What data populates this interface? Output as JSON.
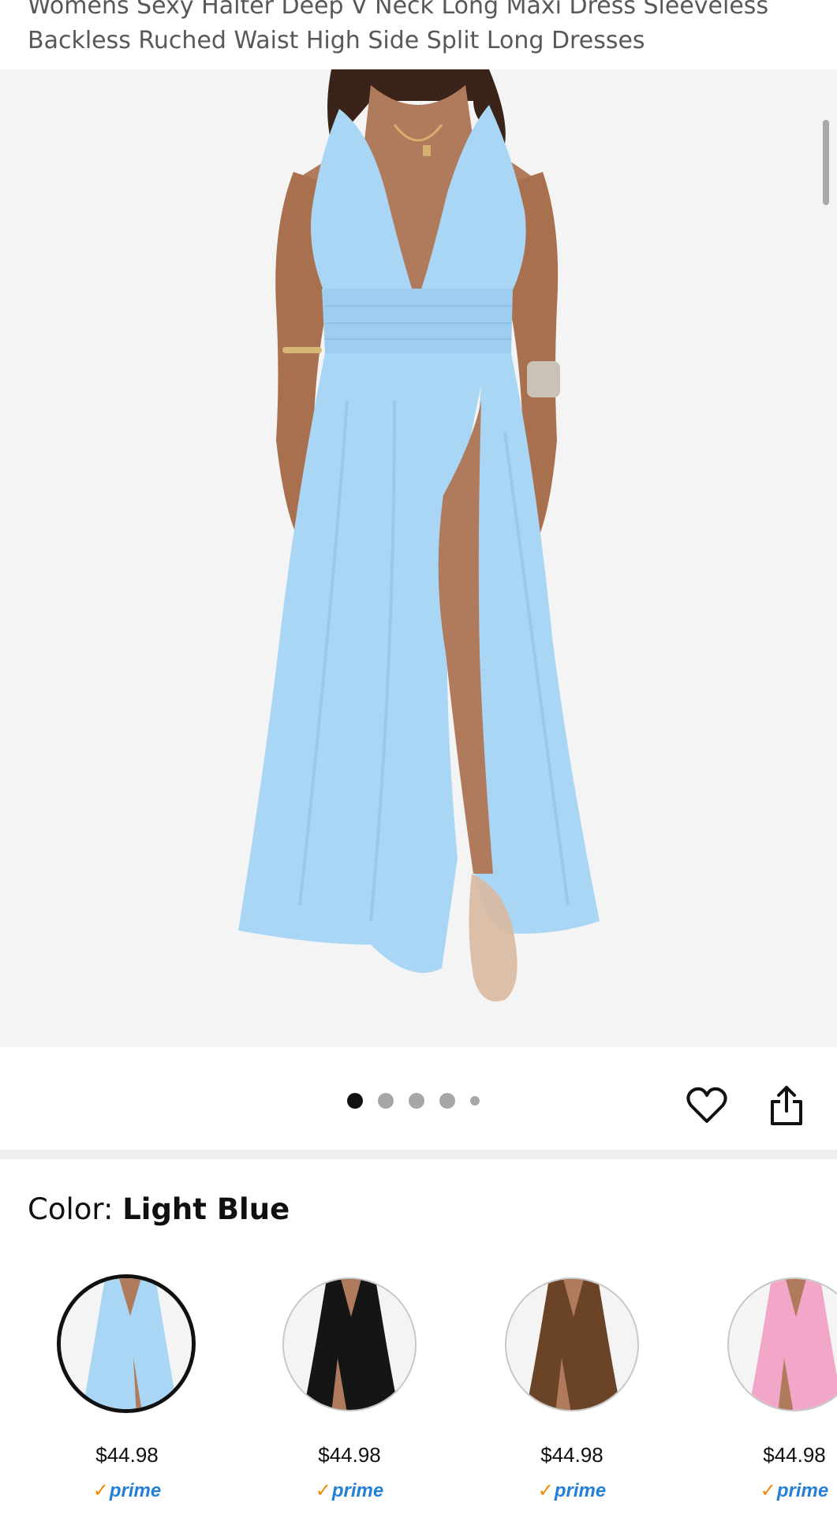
{
  "product": {
    "title": "Womens Sexy Halter Deep V Neck Long Maxi Dress Sleeveless Backless Ruched Waist High Side Split Long Dresses"
  },
  "gallery": {
    "dot_count": 5,
    "active_index": 0
  },
  "icons": {
    "favorite": "heart-icon",
    "share": "share-icon"
  },
  "color": {
    "label": "Color:",
    "selected_name": "Light Blue"
  },
  "swatches": [
    {
      "price": "$44.98",
      "prime": "prime",
      "dress_color": "#a9d6f5",
      "selected": true
    },
    {
      "price": "$44.98",
      "prime": "prime",
      "dress_color": "#151515",
      "selected": false
    },
    {
      "price": "$44.98",
      "prime": "prime",
      "dress_color": "#6b4428",
      "selected": false
    },
    {
      "price": "$44.98",
      "prime": "prime",
      "dress_color": "#f2a6c8",
      "selected": false
    }
  ],
  "colors": {
    "accent_prime": "#2480d6",
    "prime_check": "#f08804",
    "dress_main": "#a9d6f5",
    "skin": "#b07a5c"
  }
}
